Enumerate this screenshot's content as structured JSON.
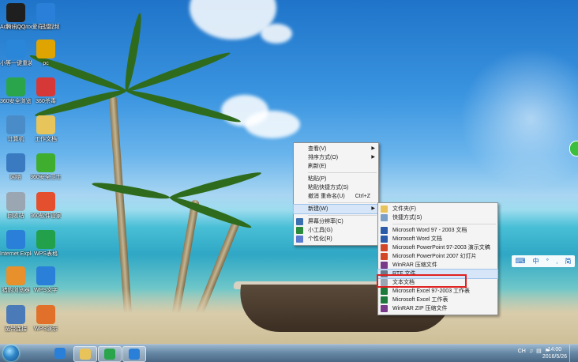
{
  "desktop_icons": [
    {
      "label": "Administrator",
      "color": "#d9c074"
    },
    {
      "label": "爱奇艺视频",
      "color": "#1fb84a"
    },
    {
      "label": "小等一键重装",
      "color": "#2a86d8"
    },
    {
      "label": "pc",
      "color": "#e0a400"
    },
    {
      "label": "360安全浏览器",
      "color": "#2aa54b"
    },
    {
      "label": "360杀毒",
      "color": "#d63838"
    },
    {
      "label": "计算机",
      "color": "#4a8cc8"
    },
    {
      "label": "工作文档",
      "color": "#e8c55a"
    },
    {
      "label": "网络",
      "color": "#3a7ac0"
    },
    {
      "label": "360安全卫士",
      "color": "#3fae2f"
    },
    {
      "label": "回收站",
      "color": "#9aa7b3"
    },
    {
      "label": "360软件管家",
      "color": "#e44f2d"
    },
    {
      "label": "Internet Explorer",
      "color": "#2a7fd8"
    },
    {
      "label": "WPS表格",
      "color": "#22a04a"
    },
    {
      "label": "猎豹浏览器",
      "color": "#e8902b"
    },
    {
      "label": "WPS文字",
      "color": "#2a7fd8"
    },
    {
      "label": "宽带连接",
      "color": "#4a7ab8"
    },
    {
      "label": "WPS演示",
      "color": "#e0702a"
    },
    {
      "label": "腾讯QQ",
      "color": "#1f1f1f"
    },
    {
      "label": "迅雷",
      "color": "#2a7fd8"
    }
  ],
  "context_menu": {
    "items": [
      {
        "label": "查看(V)",
        "type": "submenu"
      },
      {
        "label": "排序方式(O)",
        "type": "submenu"
      },
      {
        "label": "刷新(E)",
        "type": "item"
      },
      {
        "type": "separator"
      },
      {
        "label": "粘贴(P)",
        "type": "item"
      },
      {
        "label": "粘贴快捷方式(S)",
        "type": "item"
      },
      {
        "label": "撤消 重命名(U)",
        "shortcut": "Ctrl+Z",
        "type": "item"
      },
      {
        "type": "separator"
      },
      {
        "label": "新建(W)",
        "type": "submenu",
        "highlight": true
      },
      {
        "type": "separator"
      },
      {
        "label": "屏幕分辨率(C)",
        "type": "item",
        "icon": "screen-icon",
        "color": "#3a6fb0"
      },
      {
        "label": "小工具(G)",
        "type": "item",
        "icon": "gadget-icon",
        "color": "#2c8a3c"
      },
      {
        "label": "个性化(R)",
        "type": "item",
        "icon": "personalize-icon",
        "color": "#5a7ad0"
      }
    ]
  },
  "new_submenu": {
    "items": [
      {
        "label": "文件夹(F)",
        "icon": "folder-icon",
        "color": "#e8c35a"
      },
      {
        "label": "快捷方式(S)",
        "icon": "shortcut-icon",
        "color": "#7aa0c8"
      },
      {
        "type": "separator"
      },
      {
        "label": "Microsoft Word 97 - 2003 文档",
        "icon": "word-icon",
        "color": "#2a5aa8"
      },
      {
        "label": "Microsoft Word 文档",
        "icon": "word-icon",
        "color": "#2a5aa8"
      },
      {
        "label": "Microsoft PowerPoint 97-2003 演示文稿",
        "icon": "powerpoint-icon",
        "color": "#d24726"
      },
      {
        "label": "Microsoft PowerPoint 2007 幻灯片",
        "icon": "powerpoint-icon",
        "color": "#d24726"
      },
      {
        "label": "WinRAR 压缩文件",
        "icon": "winrar-icon",
        "color": "#7a3a8a"
      },
      {
        "label": "RTF 文件",
        "icon": "rtf-icon",
        "color": "#6a7a8a",
        "highlight": true
      },
      {
        "label": "文本文档",
        "icon": "text-document-icon",
        "color": "#9aa6b4"
      },
      {
        "label": "Microsoft Excel 97-2003 工作表",
        "icon": "excel-icon",
        "color": "#1e7a3c"
      },
      {
        "label": "Microsoft Excel 工作表",
        "icon": "excel-icon",
        "color": "#1e7a3c"
      },
      {
        "label": "WinRAR ZIP 压缩文件",
        "icon": "winrar-zip-icon",
        "color": "#7a3a8a"
      }
    ]
  },
  "language_bar": [
    "中",
    "°",
    ",",
    "简"
  ],
  "taskbar": {
    "apps": [
      {
        "name": "ie-icon",
        "color": "#2a7fd8"
      },
      {
        "name": "explorer-icon",
        "color": "#e8c35a"
      },
      {
        "name": "360-browser-icon",
        "color": "#2aa54b"
      },
      {
        "name": "wps-icon",
        "color": "#2a7fd8"
      }
    ],
    "tray_text": "CH",
    "time": "14:00",
    "date": "2016/5/26"
  }
}
